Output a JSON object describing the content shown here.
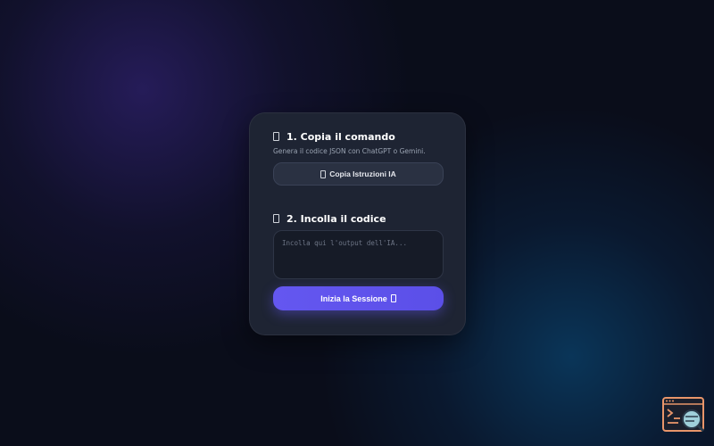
{
  "step1": {
    "title": "1. Copia il comando",
    "description": "Genera il codice JSON con ChatGPT o Gemini.",
    "copy_button_label": "Copia Istruzioni IA"
  },
  "step2": {
    "title": "2. Incolla il codice",
    "input_value": "",
    "input_placeholder": "Incolla qui l'output dell'IA...",
    "start_button_label": "Inizia la Sessione"
  },
  "colors": {
    "accent": "#6457f0",
    "card": "#1e2433",
    "background": "#0a0d1a",
    "widget": "#e8956a"
  },
  "icons": {
    "step1": "clipboard-emoji-icon",
    "step2": "paste-emoji-icon",
    "copy_button": "copy-emoji-icon",
    "start_button": "rocket-emoji-icon",
    "corner": "code-search-icon"
  }
}
